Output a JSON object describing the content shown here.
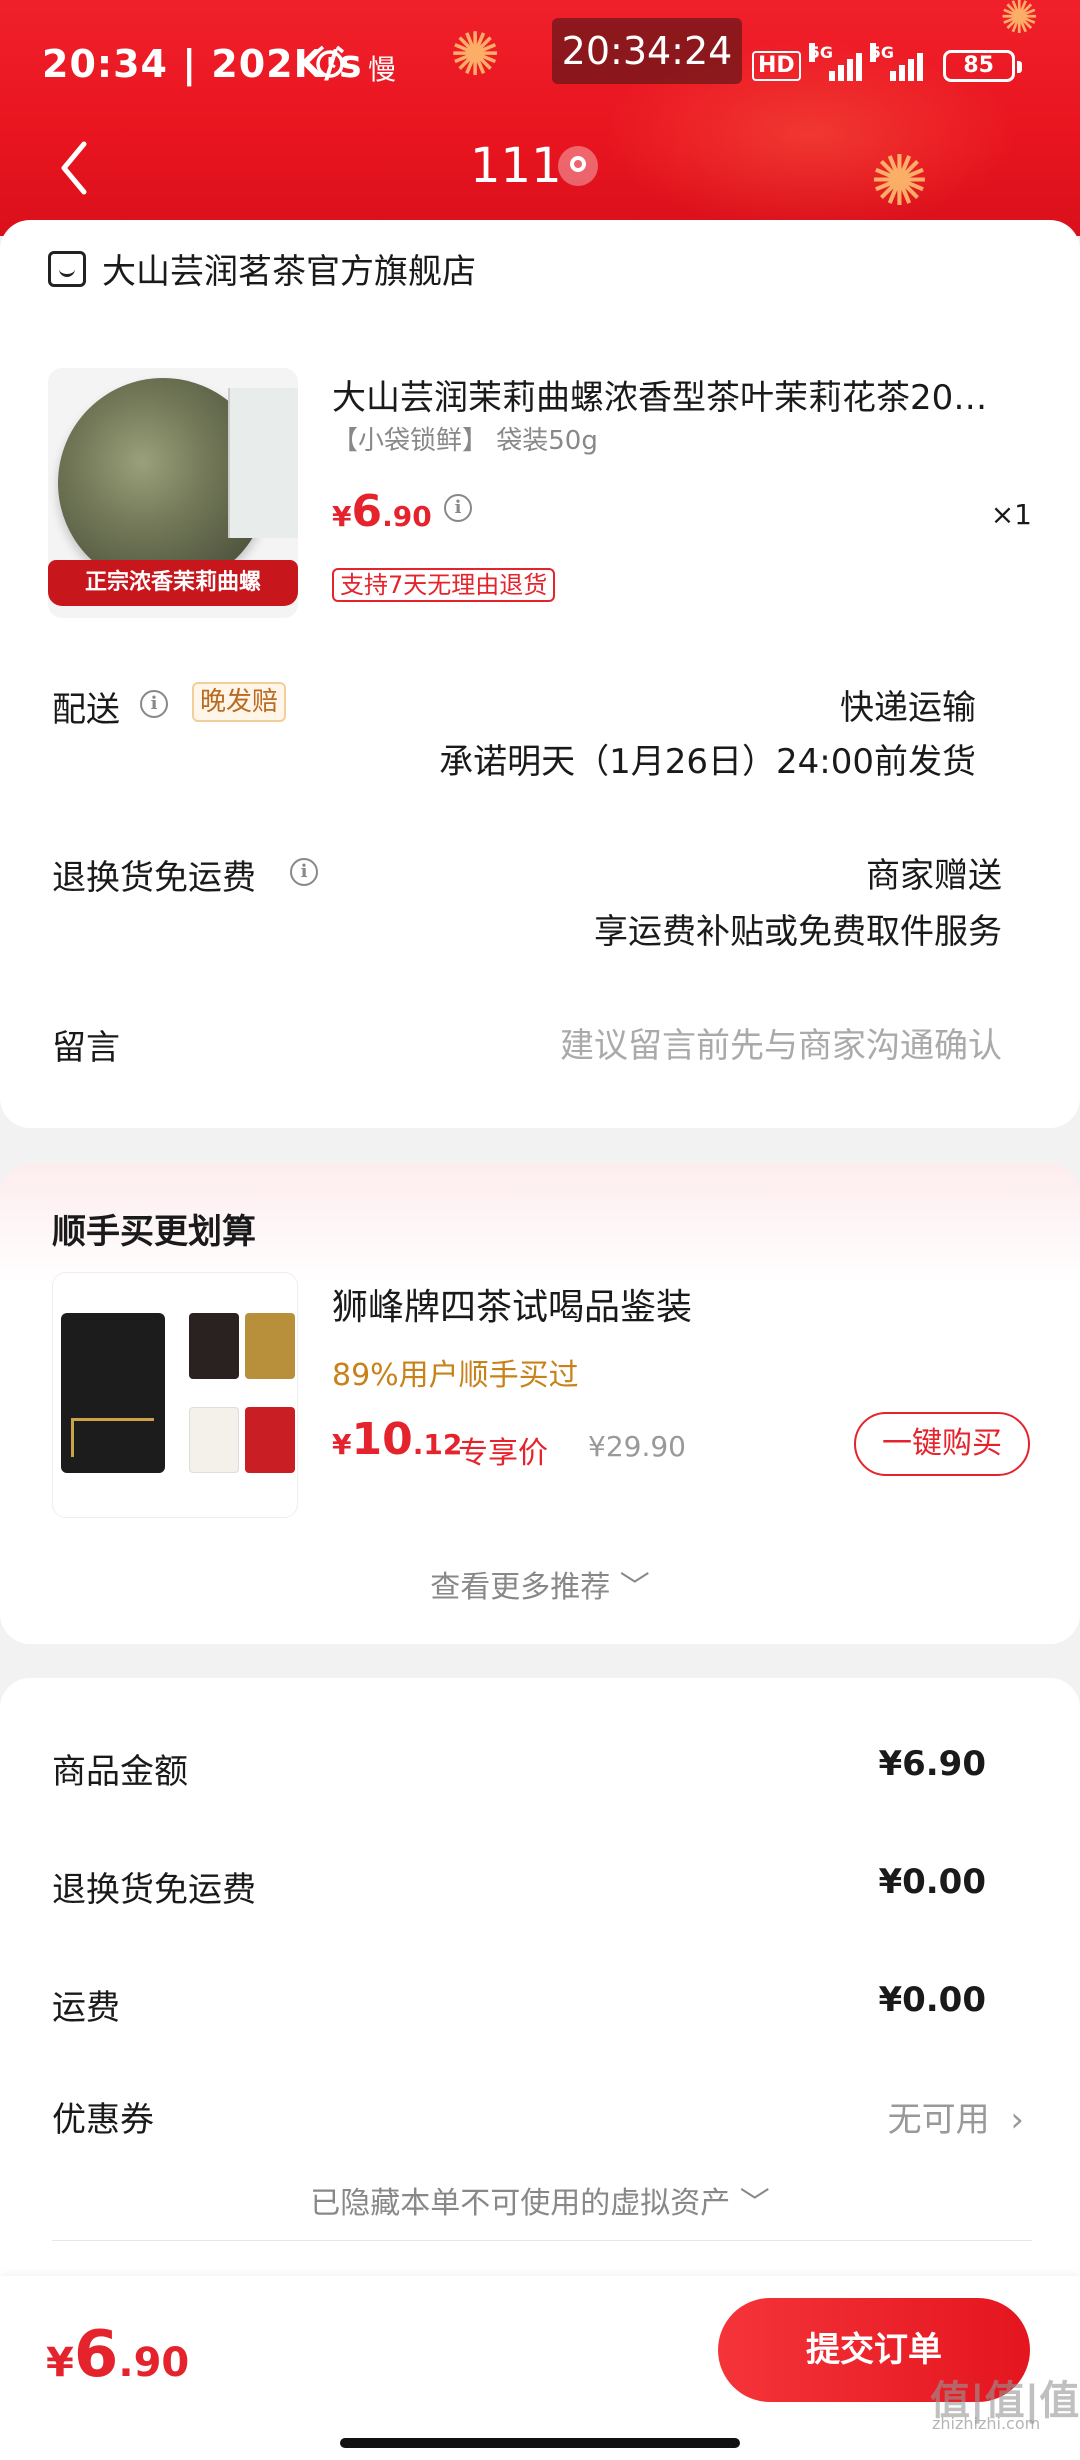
{
  "status_bar": {
    "time": "20:34 | 202K/s",
    "slow_label": "慢",
    "clock_overlay": "20:34:24",
    "hd_label": "HD",
    "net_label": "5G",
    "battery": "85"
  },
  "nav": {
    "title": "111"
  },
  "shop": {
    "name": "大山芸润茗茶官方旗舰店"
  },
  "product": {
    "title": "大山芸润茉莉曲螺浓香型茶叶茉莉花茶20…",
    "spec": "【小袋锁鲜】 袋装50g",
    "image_banner": "正宗浓香茉莉曲螺",
    "price_currency": "¥",
    "price_int": "6",
    "price_dec": ".90",
    "quantity": "×1",
    "return_policy": "支持7天无理由退货"
  },
  "delivery": {
    "label": "配送",
    "tag": "晚发赔",
    "method": "快递运输",
    "promise": "承诺明天（1月26日）24:00前发货"
  },
  "free_return": {
    "label": "退换货免运费",
    "value": "商家赠送",
    "desc": "享运费补贴或免费取件服务"
  },
  "message": {
    "label": "留言",
    "placeholder": "建议留言前先与商家沟通确认"
  },
  "upsell": {
    "title": "顺手买更划算",
    "item_name": "狮峰牌四茶试喝品鉴装",
    "item_stat": "89%用户顺手买过",
    "price_currency": "¥",
    "price_int": "10",
    "price_dec": ".12",
    "exclusive_label": "专享价",
    "original_price": "¥29.90",
    "buy_button": "一键购买",
    "more_link": "查看更多推荐"
  },
  "summary": {
    "rows": [
      {
        "label": "商品金额",
        "value": "¥6.90"
      },
      {
        "label": "退换货免运费",
        "value": "¥0.00"
      },
      {
        "label": "运费",
        "value": "¥0.00"
      },
      {
        "label": "优惠券",
        "value": "无可用"
      }
    ],
    "hidden_note": "已隐藏本单不可使用的虚拟资产"
  },
  "footer": {
    "total_currency": "¥",
    "total_int": "6",
    "total_dec": ".90",
    "submit_button": "提交订单",
    "watermark": "值|值|值",
    "watermark_sub": "zhizhizhi.com"
  },
  "colors": {
    "brand_red": "#e5232c",
    "header_red": "#f0202a",
    "gold_text": "#c8821a"
  }
}
